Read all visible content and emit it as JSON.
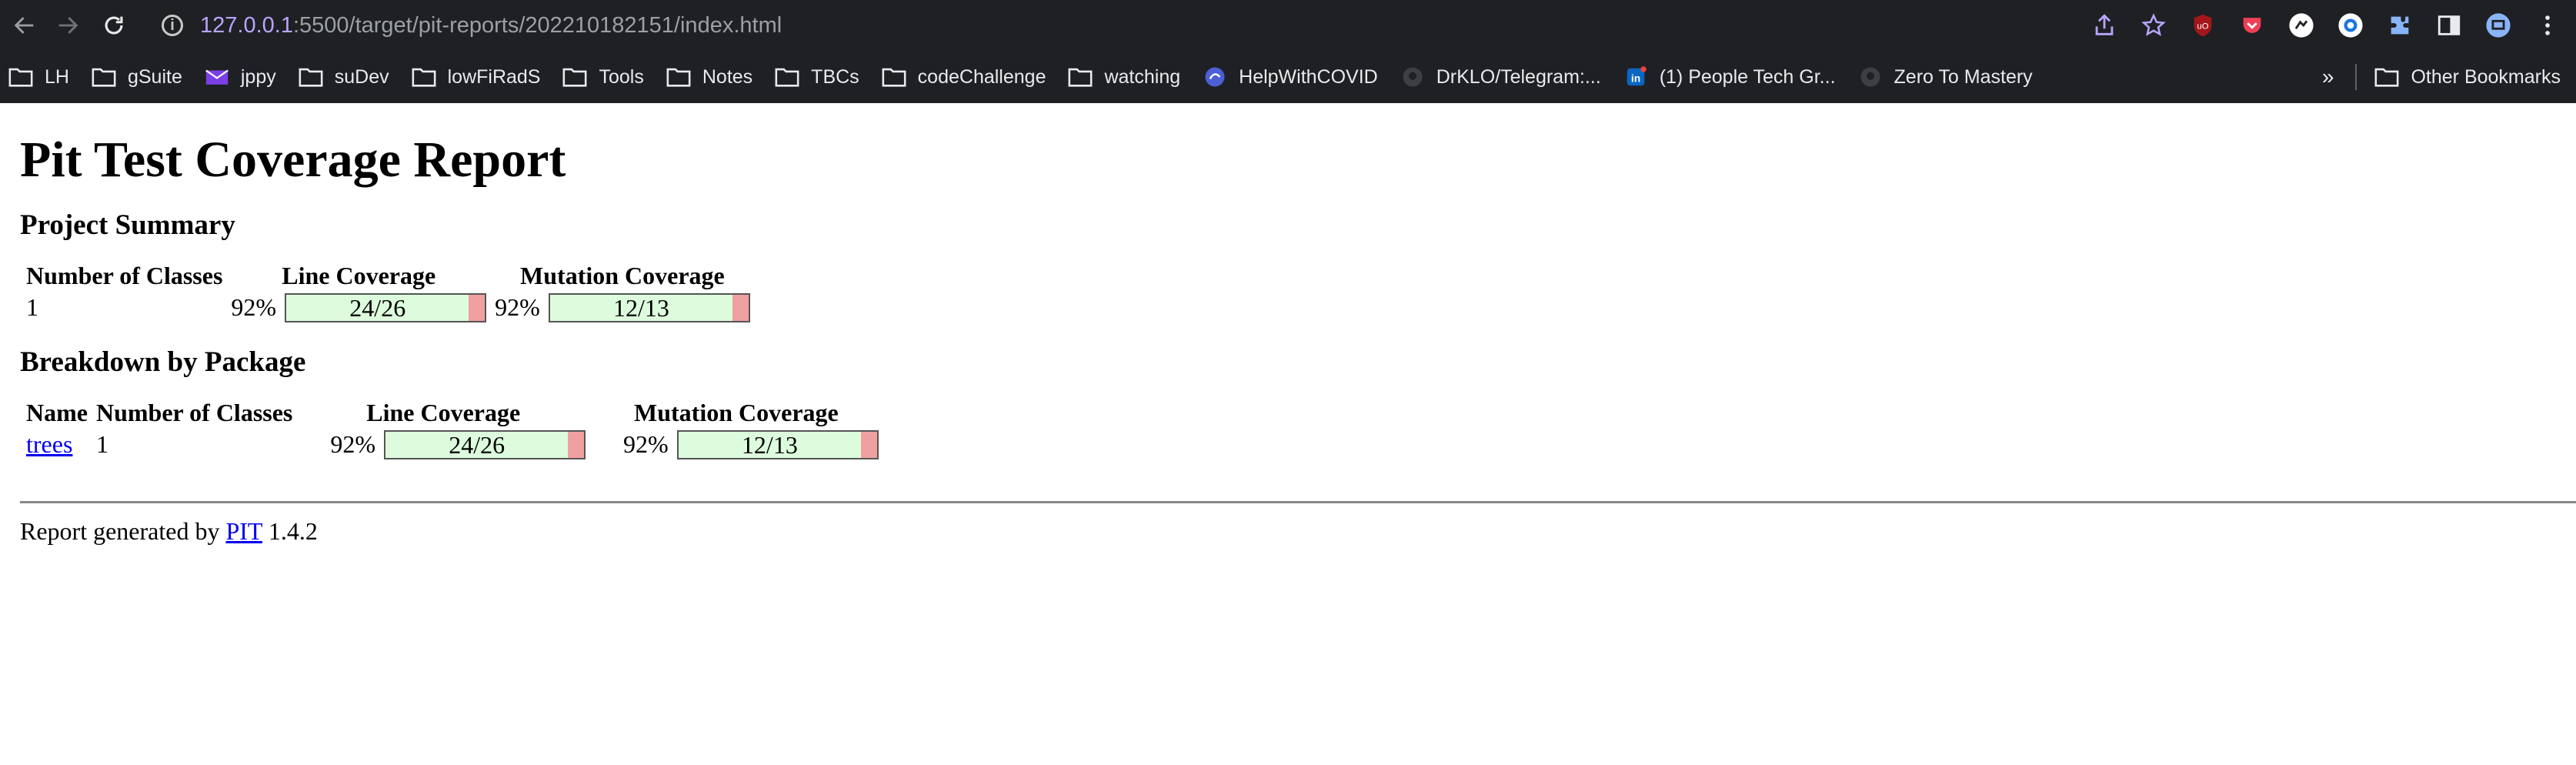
{
  "browser": {
    "url_host": "127.0.0.1",
    "url_rest": ":5500/target/pit-reports/202210182151/index.html",
    "bookmarks": [
      {
        "label": "LH",
        "icon": "folder-icon"
      },
      {
        "label": "gSuite",
        "icon": "folder-icon"
      },
      {
        "label": "jppy",
        "icon": "mail-icon"
      },
      {
        "label": "suDev",
        "icon": "folder-icon"
      },
      {
        "label": "lowFiRadS",
        "icon": "folder-icon"
      },
      {
        "label": "Tools",
        "icon": "folder-icon"
      },
      {
        "label": "Notes",
        "icon": "folder-icon"
      },
      {
        "label": "TBCs",
        "icon": "folder-icon"
      },
      {
        "label": "codeChallenge",
        "icon": "folder-icon"
      },
      {
        "label": "watching",
        "icon": "folder-icon"
      },
      {
        "label": "HelpWithCOVID",
        "icon": "globe-icon"
      },
      {
        "label": "DrKLO/Telegram:...",
        "icon": "github-icon"
      },
      {
        "label": "(1) People Tech Gr...",
        "icon": "linkedin-icon"
      },
      {
        "label": "Zero To Mastery",
        "icon": "github-icon"
      }
    ],
    "other_bookmarks": "Other Bookmarks",
    "overflow": "»"
  },
  "report": {
    "title": "Pit Test Coverage Report",
    "project_summary": {
      "heading": "Project Summary",
      "headers": {
        "classes": "Number of Classes",
        "line": "Line Coverage",
        "mutation": "Mutation Coverage"
      },
      "classes": "1",
      "line_pct": "92%",
      "line_label": "24/26",
      "line_fraction": 0.92,
      "mutation_pct": "92%",
      "mutation_label": "12/13",
      "mutation_fraction": 0.92
    },
    "breakdown": {
      "heading": "Breakdown by Package",
      "headers": {
        "name": "Name",
        "classes": "Number of Classes",
        "line": "Line Coverage",
        "mutation": "Mutation Coverage"
      },
      "rows": [
        {
          "name": "trees",
          "classes": "1",
          "line_pct": "92%",
          "line_label": "24/26",
          "line_fraction": 0.92,
          "mutation_pct": "92%",
          "mutation_label": "12/13",
          "mutation_fraction": 0.92
        }
      ]
    },
    "footer": {
      "prefix": "Report generated by",
      "link": "PIT",
      "version": "1.4.2"
    }
  },
  "colors": {
    "covered": "#ddfcdd",
    "uncovered": "#f0a0a0",
    "chrome_bg": "#1f2023"
  }
}
